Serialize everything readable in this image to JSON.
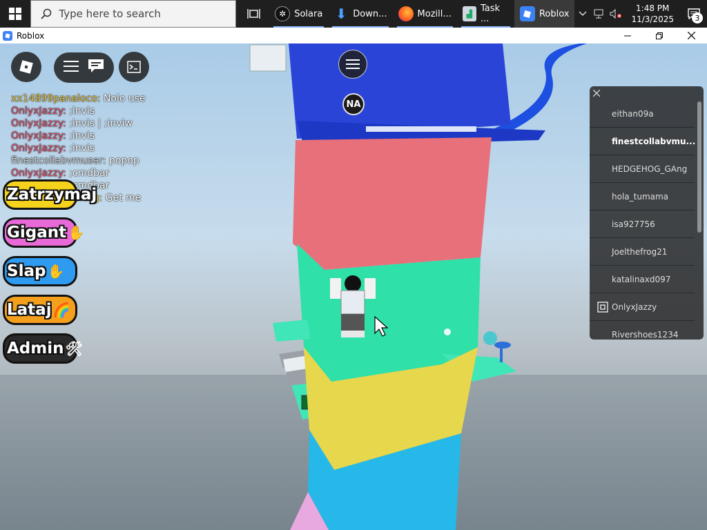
{
  "taskbar": {
    "search_placeholder": "Type here to search",
    "apps": [
      {
        "label": "Solara"
      },
      {
        "label": "Down..."
      },
      {
        "label": "Mozill..."
      },
      {
        "label": "Task ..."
      },
      {
        "label": "Roblox"
      }
    ],
    "clock": {
      "time": "1:48 PM",
      "date": "11/3/2025"
    },
    "notification_count": "3"
  },
  "window": {
    "title": "Roblox"
  },
  "chat": [
    {
      "name": "xx14899panaloco:",
      "text": "Nolo use",
      "color": "#e8c64a"
    },
    {
      "name": "OnlyxJazzy:",
      "text": ";invis",
      "color": "#e0506a"
    },
    {
      "name": "OnlyxJazzy:",
      "text": ";invis | ;inviw",
      "color": "#e0506a"
    },
    {
      "name": "OnlyxJazzy:",
      "text": ";invis",
      "color": "#e0506a"
    },
    {
      "name": "OnlyxJazzy:",
      "text": ";invis",
      "color": "#e0506a"
    },
    {
      "name": "finestcollabvmuser:",
      "text": "popop",
      "color": "#d0d0d0"
    },
    {
      "name": "OnlyxJazzy:",
      "text": ";cmdbar",
      "color": "#e0506a"
    },
    {
      "name": "OnlyxJazzy:",
      "text": ";cmdbar",
      "color": "#e0506a"
    },
    {
      "name": "HEDGEHOG_GAng:",
      "text": "Get me",
      "color": "#e8c64a"
    }
  ],
  "command_buttons": [
    {
      "label": "Zatrzymaj",
      "emoji": "",
      "color": "#f5d21c"
    },
    {
      "label": "Gigant",
      "emoji": "✋",
      "color": "#e86ad8"
    },
    {
      "label": "Slap",
      "emoji": "✋",
      "color": "#2e9bf0"
    },
    {
      "label": "Lataj",
      "emoji": "🌈",
      "color": "#f5a01c"
    },
    {
      "label": "Admin",
      "emoji": "🛠",
      "color": "#2a2a2a"
    }
  ],
  "players": [
    {
      "name": "eithan09a"
    },
    {
      "name": "finestcollabvmu..."
    },
    {
      "name": "HEDGEHOG_GAng"
    },
    {
      "name": "hola_tumama"
    },
    {
      "name": "isa927756"
    },
    {
      "name": "Joelthefrog21"
    },
    {
      "name": "katalinaxd097"
    },
    {
      "name": "OnlyxJazzy"
    },
    {
      "name": "Rivershoes1234"
    }
  ],
  "overhead_tag": "NA"
}
